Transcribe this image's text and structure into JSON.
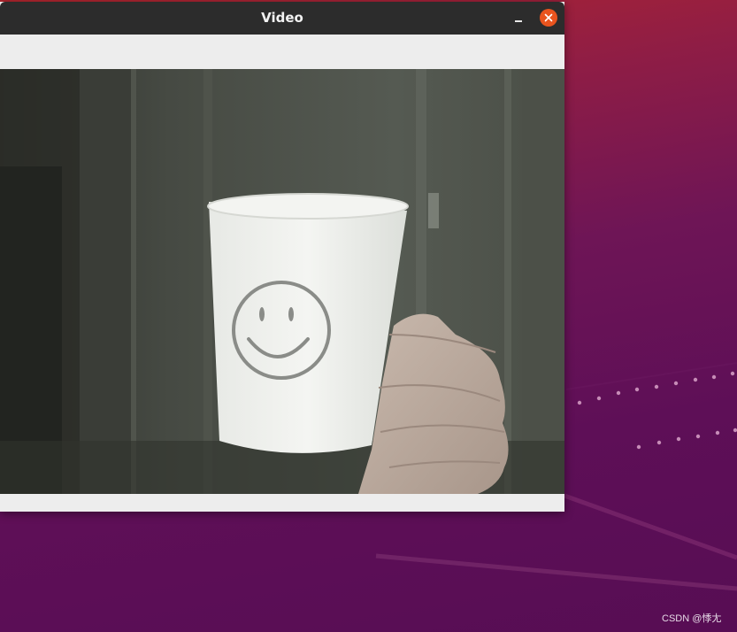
{
  "window": {
    "title": "Video"
  },
  "video": {
    "scene": "webcam-cup-with-smiley"
  },
  "desktop": {
    "watermark": "CSDN @悸尢"
  },
  "colors": {
    "titlebar": "#2c2c2c",
    "close_button": "#e9541e",
    "window_background": "#ececec",
    "desktop_top": "#b3262e",
    "desktop_bottom": "#570d54"
  },
  "icons": {
    "minimize": "minimize-icon",
    "close": "close-icon"
  }
}
